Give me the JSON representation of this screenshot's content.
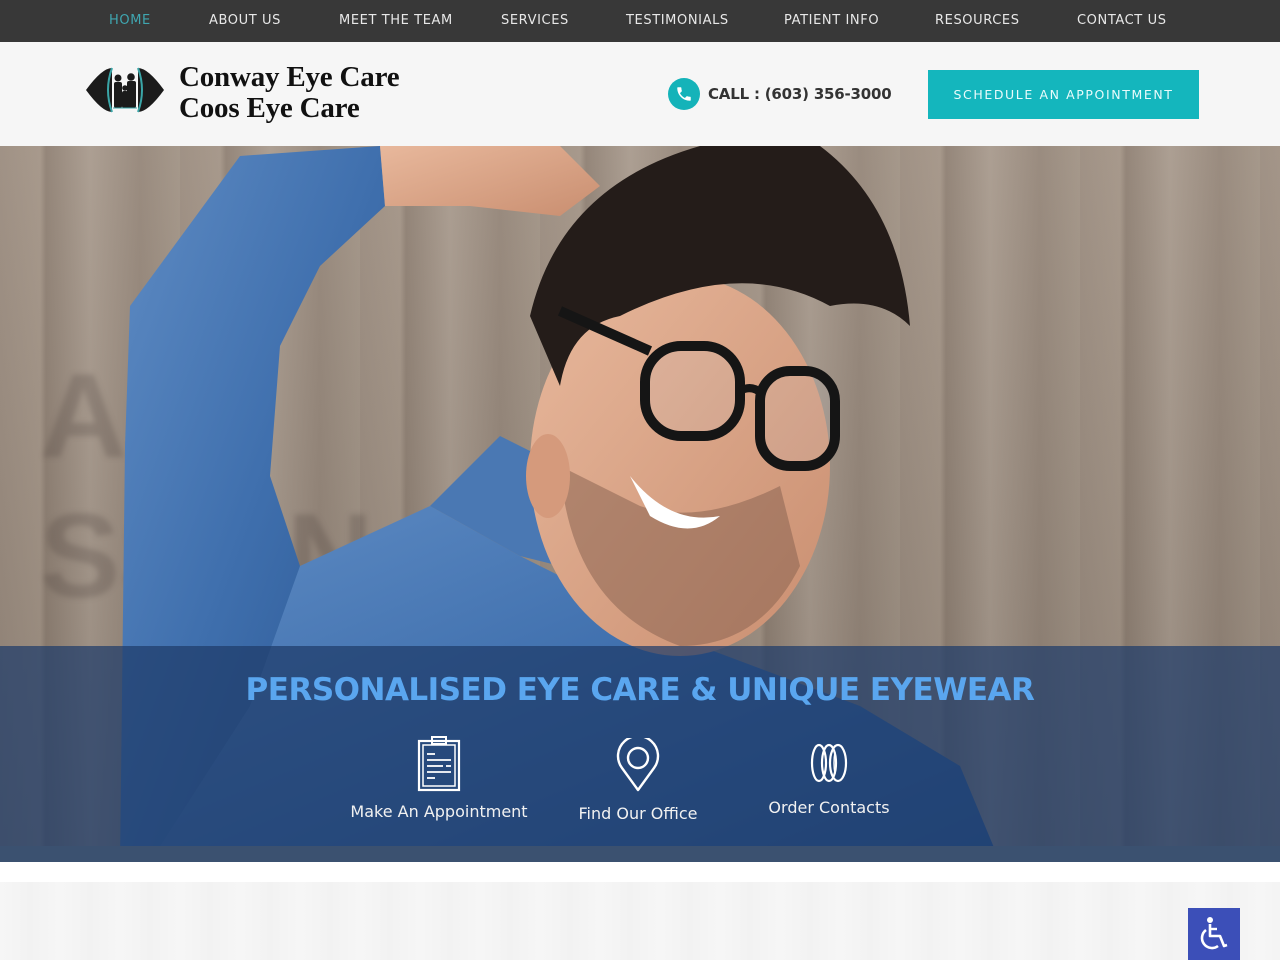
{
  "nav": {
    "items": [
      {
        "label": "HOME",
        "active": true
      },
      {
        "label": "ABOUT US",
        "active": false
      },
      {
        "label": "MEET THE TEAM",
        "active": false
      },
      {
        "label": "SERVICES",
        "active": false
      },
      {
        "label": "TESTIMONIALS",
        "active": false
      },
      {
        "label": "PATIENT INFO",
        "active": false
      },
      {
        "label": "RESOURCES",
        "active": false
      },
      {
        "label": "CONTACT US",
        "active": false
      }
    ]
  },
  "header": {
    "logo_line1": "Conway Eye Care",
    "logo_line2": "Coos Eye Care",
    "call_text": "CALL : (603) 356-3000",
    "call_icon": "phone-icon",
    "schedule_label": "SCHEDULE AN APPOINTMENT"
  },
  "hero": {
    "tagline": "PERSONALISED EYE CARE & UNIQUE EYEWEAR",
    "features": [
      {
        "label": "Make An Appointment",
        "icon": "clipboard-icon"
      },
      {
        "label": "Find Our Office",
        "icon": "map-pin-icon"
      },
      {
        "label": "Order Contacts",
        "icon": "contact-lens-icon"
      }
    ]
  },
  "accessibility": {
    "icon": "wheelchair-icon"
  },
  "colors": {
    "nav_bg": "#383838",
    "nav_active": "#3fa6b0",
    "accent_teal": "#14b6bd",
    "tagline_blue": "#5aa6ef",
    "overlay_navy": "#1e3c69",
    "a11y_blue": "#3c4fb8"
  }
}
